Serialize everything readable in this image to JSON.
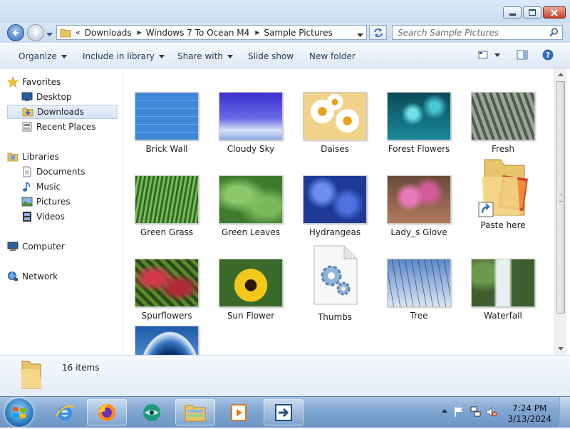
{
  "address": {
    "crumbs": [
      "Downloads",
      "Windows 7 To Ocean M4",
      "Sample Pictures"
    ],
    "search_placeholder": "Search Sample Pictures"
  },
  "toolbar": {
    "organize": "Organize",
    "include": "Include in library",
    "share": "Share with",
    "slideshow": "Slide show",
    "newfolder": "New folder"
  },
  "nav": {
    "favorites": "Favorites",
    "desktop": "Desktop",
    "downloads": "Downloads",
    "recent": "Recent Places",
    "libraries": "Libraries",
    "documents": "Documents",
    "music": "Music",
    "pictures": "Pictures",
    "videos": "Videos",
    "computer": "Computer",
    "network": "Network"
  },
  "files": [
    {
      "name": "Brick Wall",
      "thumb_color": "#3f86d6"
    },
    {
      "name": "Cloudy Sky",
      "thumb_color": "#4a4ad8"
    },
    {
      "name": "Daises",
      "thumb_color": "#f0d28a"
    },
    {
      "name": "Forest Flowers",
      "thumb_color": "#1a8a9a"
    },
    {
      "name": "Fresh",
      "thumb_color": "#7d8a7a"
    },
    {
      "name": "Green Grass",
      "thumb_color": "#4f8a3a"
    },
    {
      "name": "Green Leaves",
      "thumb_color": "#5e9a48"
    },
    {
      "name": "Hydrangeas",
      "thumb_color": "#2d4fb0"
    },
    {
      "name": "Lady_s Glove",
      "thumb_color": "#c8559a"
    },
    {
      "name": "Paste here",
      "thumb_color": "#e8c26a"
    },
    {
      "name": "Spurflowers",
      "thumb_color": "#8a2a3a"
    },
    {
      "name": "Sun Flower",
      "thumb_color": "#e0b818"
    },
    {
      "name": "Thumbs",
      "thumb_color": "#f2f2f2"
    },
    {
      "name": "Tree",
      "thumb_color": "#5b87c8"
    },
    {
      "name": "Waterfall",
      "thumb_color": "#4a6e3a"
    },
    {
      "name": "",
      "thumb_color": "#1e5aa8"
    }
  ],
  "details": {
    "count": "16 items"
  },
  "taskbar": {
    "time": "7:24 PM",
    "date": "3/13/2024"
  }
}
